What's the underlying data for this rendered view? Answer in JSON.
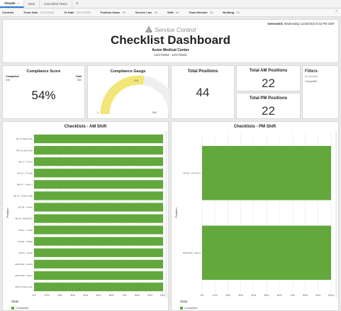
{
  "tabs": [
    {
      "label": "Visuals",
      "active": true
    },
    {
      "label": "Data",
      "active": false
    },
    {
      "label": "Cancelled Tasks",
      "active": false
    }
  ],
  "controls": {
    "label": "Controls",
    "items": [
      {
        "key": "From Date",
        "value": "12/17/2024"
      },
      {
        "key": "To Date",
        "value": "12/17/2024"
      },
      {
        "key": "Position Name",
        "value": "All"
      },
      {
        "key": "Service Line",
        "value": "All"
      },
      {
        "key": "Shift",
        "value": "All"
      },
      {
        "key": "Team Member",
        "value": "All"
      },
      {
        "key": "Building",
        "value": "All"
      }
    ]
  },
  "header": {
    "generated_label": "Generated:",
    "generated_value": "Wednesday 12/18/2024 9:42 PM GMT",
    "brand": "Service Control",
    "title": "Checklist Dashboard",
    "center": "Acme Medical Center",
    "date_range": "12/17/2024 - 12/17/2024"
  },
  "compliance": {
    "title": "Compliance Score",
    "completed_label": "Completed",
    "completed_value": "318",
    "total_label": "Total",
    "total_value": "584",
    "percent": "54%"
  },
  "gauge": {
    "title": "Compliance Gauge",
    "value_label": "318",
    "min_label": "0",
    "max_label": "584",
    "value": 318,
    "max": 584,
    "fill_color": "#f2e679",
    "track_color": "#efefef"
  },
  "totals": {
    "positions_title": "Total Positions",
    "positions_value": "44",
    "am_title": "Total AM Positions",
    "am_value": "22",
    "pm_title": "Total PM Positions",
    "pm_value": "22"
  },
  "filters": {
    "title": "Filters",
    "sub": "(Excluded)",
    "value": "Cancelled"
  },
  "chart_data": [
    {
      "type": "bar",
      "orientation": "horizontal",
      "title": "Checklists - AM Shift",
      "ylabel": "Position",
      "xlim": [
        0,
        100
      ],
      "x_ticks": [
        "0%",
        "10%",
        "20%",
        "30%",
        "40%",
        "50%",
        "60%",
        "70%",
        "80%",
        "90%",
        "100%"
      ],
      "categories": [
        "AM 17 Night Tech",
        "AM 16 Lead Tech",
        "AM 14 - 2 PCU",
        "AM 15 - 3 South",
        "AM 10 - 4 East 1",
        "AM 11 - 5 West (AB)",
        "AM 08 - 4 West",
        "AM 09 - West/PCU",
        "AM 07 - 4 East",
        "AM 06 - 3 West",
        "AM 05 - 3 East",
        "AM 04 ED - Side B",
        "AM 03 ED - Side A",
        "AM 02 Police Tech"
      ],
      "values": [
        100,
        100,
        100,
        100,
        100,
        100,
        100,
        100,
        100,
        100,
        100,
        100,
        100,
        100
      ],
      "series_color": "#62a83d",
      "state_label": "State",
      "legend": [
        {
          "label": "Completed",
          "color": "#62a83d"
        }
      ]
    },
    {
      "type": "bar",
      "orientation": "horizontal",
      "title": "Checklists - PM Shift",
      "ylabel": "Position",
      "xlim": [
        0,
        100
      ],
      "x_ticks": [
        "0%",
        "10%",
        "20%",
        "30%",
        "40%",
        "50%",
        "60%",
        "70%",
        "80%",
        "90%",
        "100%"
      ],
      "categories": [
        "PM 00 - OUTOF A",
        "PM 03 ED - Side A"
      ],
      "values": [
        100,
        100
      ],
      "series_color": "#62a83d",
      "state_label": "State",
      "legend": [
        {
          "label": "Completed",
          "color": "#62a83d"
        }
      ]
    }
  ]
}
